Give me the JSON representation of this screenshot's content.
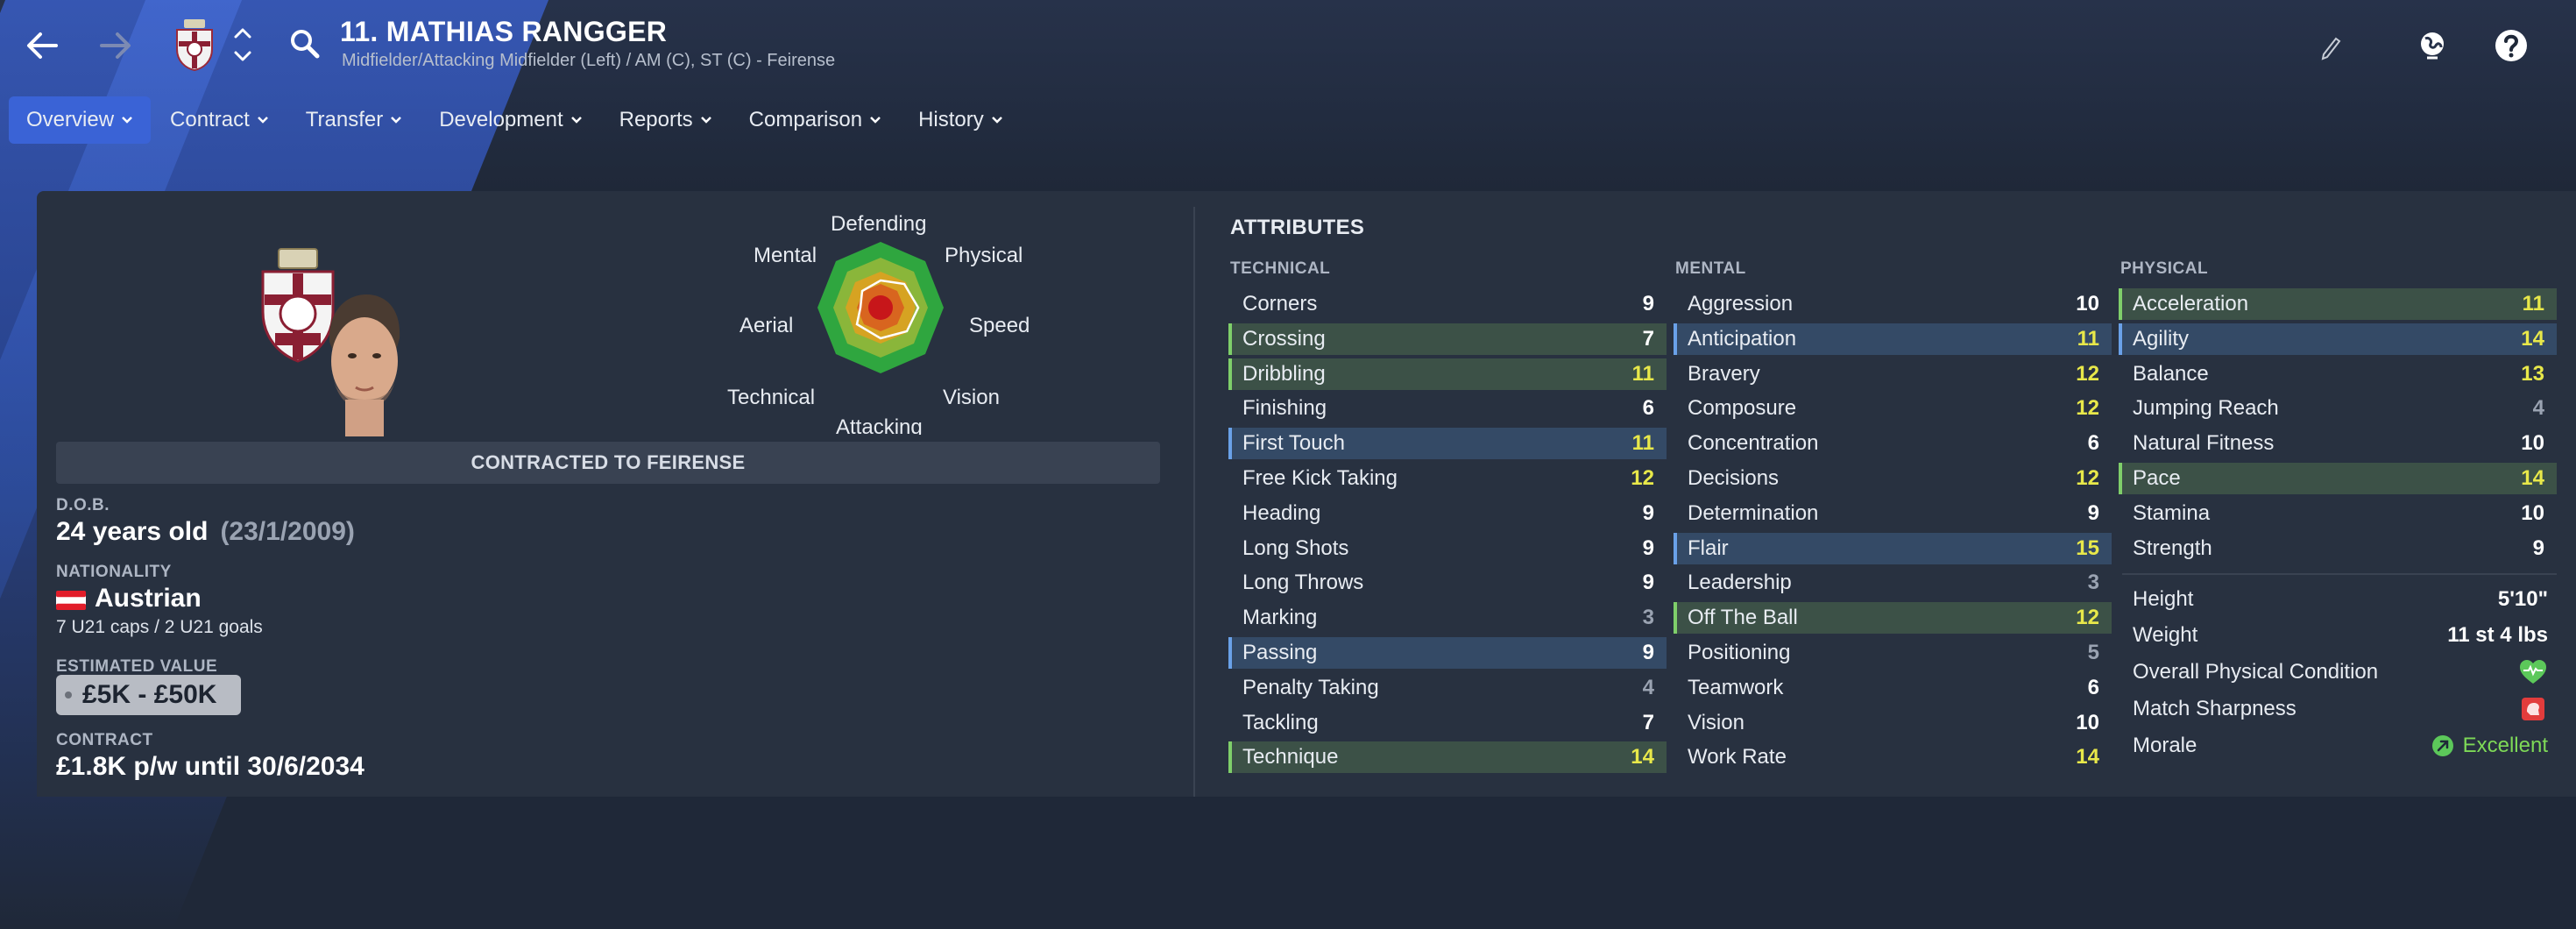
{
  "header": {
    "title": "11. MATHIAS RANGGER",
    "subtitle": "Midfielder/Attacking Midfielder (Left) / AM (C), ST (C) - Feirense",
    "icons": [
      "back-arrow-icon",
      "forward-arrow-icon",
      "club-crest-icon",
      "up-down-icon",
      "search-icon",
      "pencil-icon",
      "globe-icon",
      "help-icon"
    ]
  },
  "tabs": [
    "Overview",
    "Contract",
    "Transfer",
    "Development",
    "Reports",
    "Comparison",
    "History"
  ],
  "radar": {
    "labels": {
      "defending": "Defending",
      "physical": "Physical",
      "speed": "Speed",
      "vision": "Vision",
      "attacking": "Attacking",
      "technical": "Technical",
      "aerial": "Aerial",
      "mental": "Mental"
    }
  },
  "profile": {
    "contract_banner": "CONTRACTED TO FEIRENSE",
    "dob_label": "D.O.B.",
    "age": "24 years old",
    "dob": "(23/1/2009)",
    "nationality_label": "NATIONALITY",
    "nationality": "Austrian",
    "caps": "7 U21 caps / 2 U21 goals",
    "value_label": "ESTIMATED VALUE",
    "value": "£5K - £50K",
    "contract_label": "CONTRACT",
    "contract": "£1.8K p/w until 30/6/2034"
  },
  "attributes": {
    "title": "ATTRIBUTES",
    "technical": {
      "heading": "TECHNICAL",
      "items": [
        {
          "name": "Corners",
          "value": "9",
          "hl": ""
        },
        {
          "name": "Crossing",
          "value": "7",
          "hl": "green"
        },
        {
          "name": "Dribbling",
          "value": "11",
          "hl": "green"
        },
        {
          "name": "Finishing",
          "value": "6",
          "hl": ""
        },
        {
          "name": "First Touch",
          "value": "11",
          "hl": "blue"
        },
        {
          "name": "Free Kick Taking",
          "value": "12",
          "hl": ""
        },
        {
          "name": "Heading",
          "value": "9",
          "hl": ""
        },
        {
          "name": "Long Shots",
          "value": "9",
          "hl": ""
        },
        {
          "name": "Long Throws",
          "value": "9",
          "hl": ""
        },
        {
          "name": "Marking",
          "value": "3",
          "hl": ""
        },
        {
          "name": "Passing",
          "value": "9",
          "hl": "blue"
        },
        {
          "name": "Penalty Taking",
          "value": "4",
          "hl": ""
        },
        {
          "name": "Tackling",
          "value": "7",
          "hl": ""
        },
        {
          "name": "Technique",
          "value": "14",
          "hl": "green"
        }
      ]
    },
    "mental": {
      "heading": "MENTAL",
      "items": [
        {
          "name": "Aggression",
          "value": "10",
          "hl": ""
        },
        {
          "name": "Anticipation",
          "value": "11",
          "hl": "blue"
        },
        {
          "name": "Bravery",
          "value": "12",
          "hl": ""
        },
        {
          "name": "Composure",
          "value": "12",
          "hl": ""
        },
        {
          "name": "Concentration",
          "value": "6",
          "hl": ""
        },
        {
          "name": "Decisions",
          "value": "12",
          "hl": ""
        },
        {
          "name": "Determination",
          "value": "9",
          "hl": ""
        },
        {
          "name": "Flair",
          "value": "15",
          "hl": "blue"
        },
        {
          "name": "Leadership",
          "value": "3",
          "hl": ""
        },
        {
          "name": "Off The Ball",
          "value": "12",
          "hl": "green"
        },
        {
          "name": "Positioning",
          "value": "5",
          "hl": ""
        },
        {
          "name": "Teamwork",
          "value": "6",
          "hl": ""
        },
        {
          "name": "Vision",
          "value": "10",
          "hl": ""
        },
        {
          "name": "Work Rate",
          "value": "14",
          "hl": ""
        }
      ]
    },
    "physical": {
      "heading": "PHYSICAL",
      "items": [
        {
          "name": "Acceleration",
          "value": "11",
          "hl": "green"
        },
        {
          "name": "Agility",
          "value": "14",
          "hl": "blue"
        },
        {
          "name": "Balance",
          "value": "13",
          "hl": ""
        },
        {
          "name": "Jumping Reach",
          "value": "4",
          "hl": ""
        },
        {
          "name": "Natural Fitness",
          "value": "10",
          "hl": ""
        },
        {
          "name": "Pace",
          "value": "14",
          "hl": "green"
        },
        {
          "name": "Stamina",
          "value": "10",
          "hl": ""
        },
        {
          "name": "Strength",
          "value": "9",
          "hl": ""
        }
      ]
    }
  },
  "physical_extra": {
    "height_label": "Height",
    "height": "5'10\"",
    "weight_label": "Weight",
    "weight": "11 st 4 lbs",
    "condition_label": "Overall Physical Condition",
    "sharpness_label": "Match Sharpness",
    "morale_label": "Morale",
    "morale": "Excellent"
  },
  "colors": {
    "accent": "#3a63d6",
    "value_low": "#9aa3b2",
    "value_mid": "#ffffff",
    "value_high": "#e8e84a",
    "morale_green": "#7ed957"
  }
}
